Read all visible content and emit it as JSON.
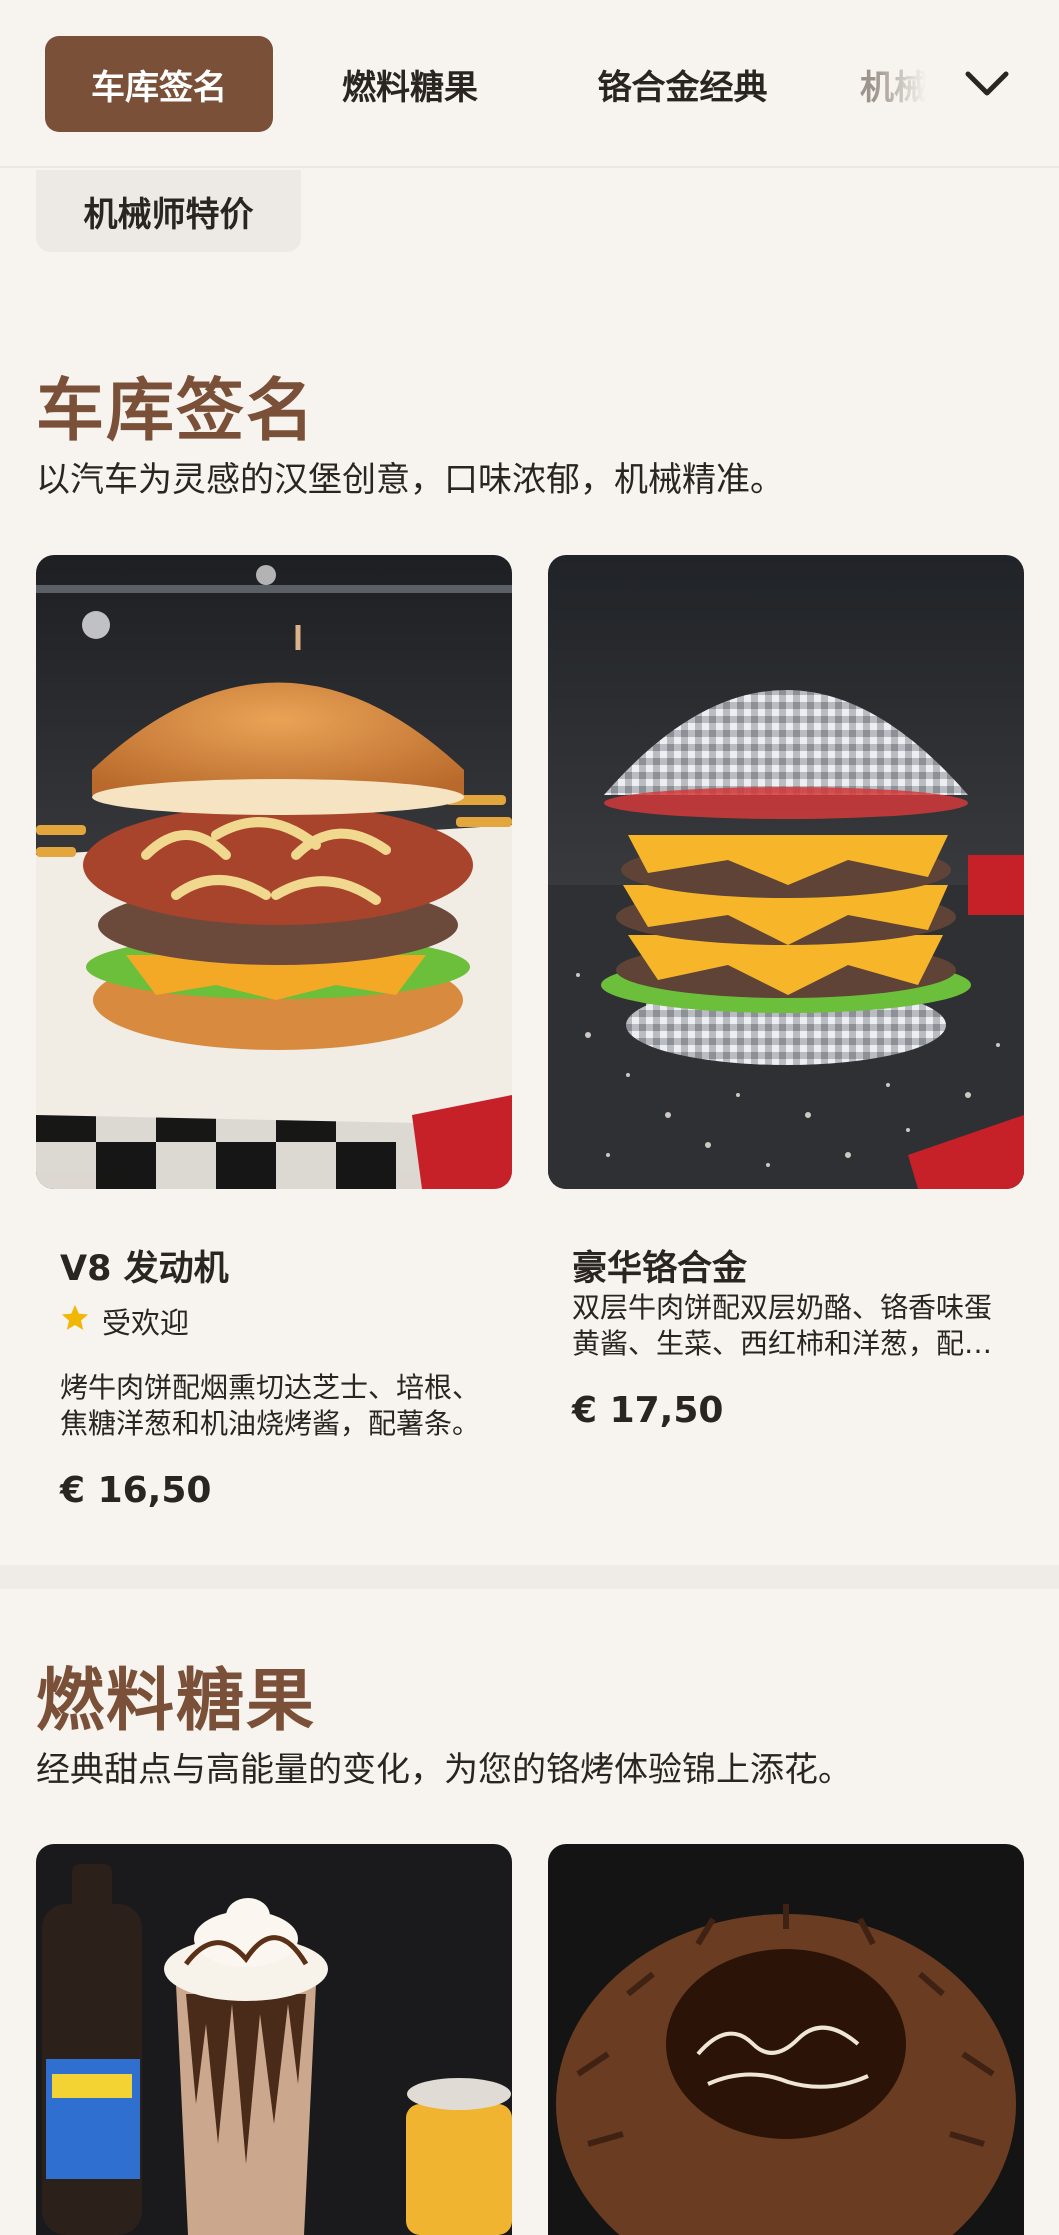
{
  "nav": {
    "tabs": [
      {
        "label": "车库签名",
        "active": true
      },
      {
        "label": "燃料糖果",
        "active": false
      },
      {
        "label": "铬合金经典",
        "active": false
      },
      {
        "label": "机械",
        "active": false
      }
    ],
    "overflow_tab": "机械师特价",
    "expand_icon": "chevron-down-icon"
  },
  "sections": [
    {
      "title": "车库签名",
      "subtitle": "以汽车为灵感的汉堡创意，口味浓郁，机械精准。",
      "items": [
        {
          "name": "V8 发动机",
          "badge": "受欢迎",
          "description": "烤牛肉饼配烟熏切达芝士、培根、焦糖洋葱和机油烧烤酱，配薯条。",
          "price": "€ 16,50"
        },
        {
          "name": "豪华铬合金",
          "description": "双层牛肉饼配双层奶酪、铬香味蛋黄酱、生菜、西红柿和洋葱，配薯条。",
          "price": "€ 17,50"
        }
      ]
    },
    {
      "title": "燃料糖果",
      "subtitle": "经典甜点与高能量的变化，为您的铬烤体验锦上添花。"
    }
  ],
  "colors": {
    "accent": "#7a5038",
    "background": "#f7f4f0",
    "star": "#f2b705"
  }
}
